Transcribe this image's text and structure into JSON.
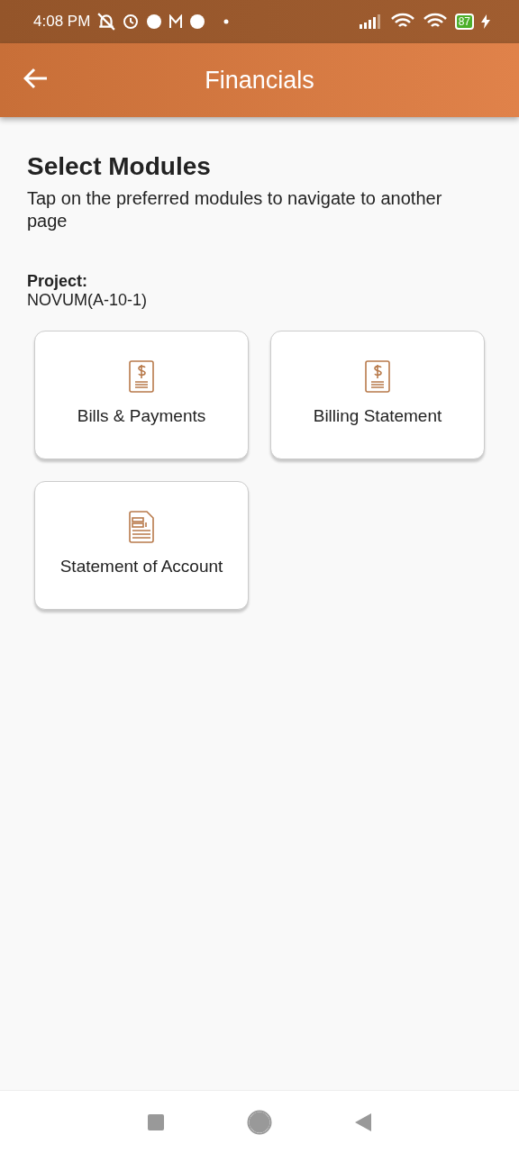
{
  "status_bar": {
    "time": "4:08 PM",
    "battery": "87"
  },
  "app_bar": {
    "title": "Financials"
  },
  "heading": "Select Modules",
  "subtitle": "Tap on the preferred modules to navigate to another page",
  "project": {
    "label": "Project:",
    "value": "NOVUM(A-10-1)"
  },
  "modules": [
    {
      "label": "Bills & Payments",
      "kind": "bill"
    },
    {
      "label": "Billing Statement",
      "kind": "bill"
    },
    {
      "label": "Statement of Account",
      "kind": "statement"
    }
  ]
}
